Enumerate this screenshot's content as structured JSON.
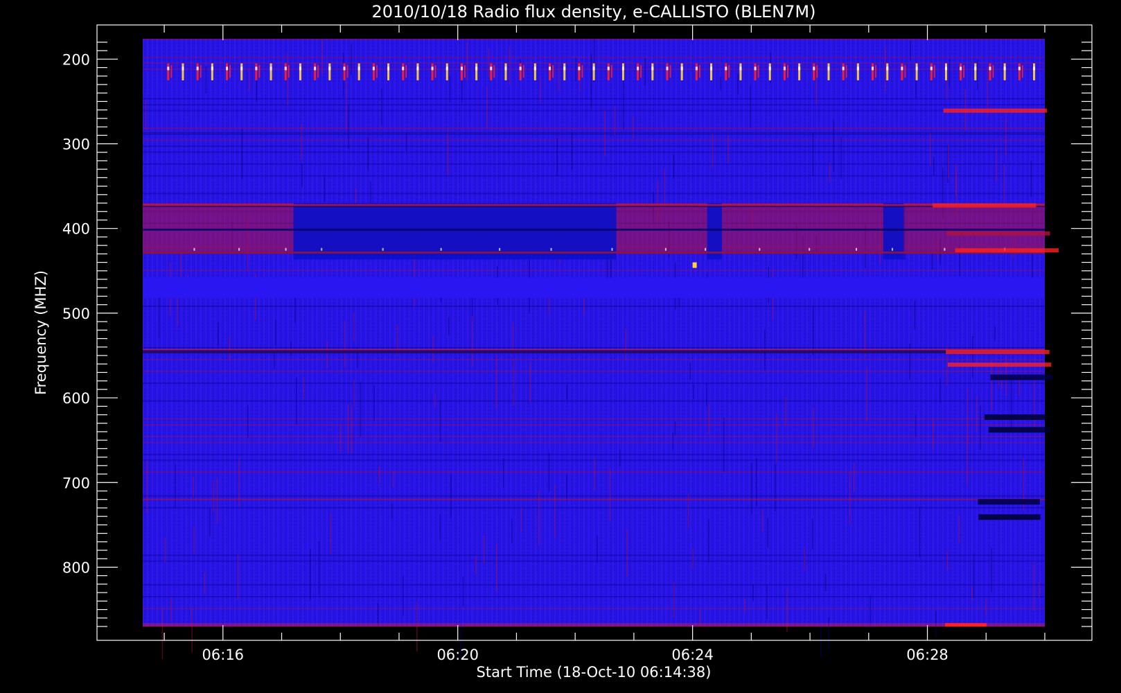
{
  "chart_data": {
    "type": "heatmap",
    "title": "2010/10/18  Radio flux density, e-CALLISTO (BLEN7M)",
    "xlabel": "Start Time (18-Oct-10 06:14:38)",
    "ylabel": "Frequency (MHZ)",
    "x_range_minutes": [
      "06:14:38",
      "06:30:00"
    ],
    "y_range_mhz": [
      176,
      870
    ],
    "y_axis_inverted": true,
    "x_tick_labels": [
      "06:16",
      "06:20",
      "06:24",
      "06:28"
    ],
    "y_tick_labels": [
      "200",
      "300",
      "400",
      "500",
      "600",
      "700",
      "800"
    ],
    "colormap": {
      "background": "#2a16f0",
      "low": "#000080",
      "mid": "#b01040",
      "high": "#ff2020",
      "peak": "#ffd040"
    },
    "features": [
      {
        "name": "periodic-bursts",
        "freq_mhz": [
          205,
          225
        ],
        "period_s": 30
      },
      {
        "name": "band-370-430",
        "freq_mhz": [
          370,
          430
        ]
      },
      {
        "name": "strong-line-545",
        "freq_mhz": [
          545,
          545
        ]
      },
      {
        "name": "late-activity",
        "time_start": "06:28",
        "freq_mhz": [
          250,
          870
        ]
      }
    ]
  }
}
